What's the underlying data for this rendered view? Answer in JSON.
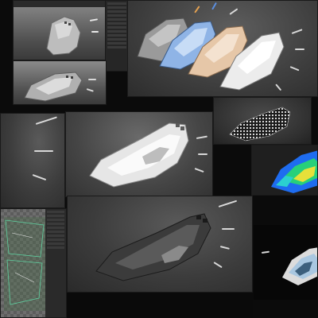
{
  "colors": {
    "background": "#0b0b0b",
    "viewport_grey": "#4e4e4e",
    "viewport_dark": "#3c3c3c",
    "model_white": "#e6e6e6",
    "model_blue": "#8fb4e6",
    "model_peach": "#e6c7a8",
    "heatmap_blue": "#1e6cf0",
    "heatmap_green": "#27d07a",
    "heatmap_yellow": "#e6e03a",
    "panel_chrome": "#2b2b2b"
  },
  "icons": {
    "close": "close-icon",
    "speed_line": "speed-line-icon"
  },
  "panels": [
    "viewport-top-left-small",
    "viewport-variants-lineup",
    "viewport-bottom-left-wide",
    "viewport-center-main",
    "viewport-wireframe",
    "viewport-heatmap",
    "viewport-uv-editor",
    "viewport-dark-render",
    "viewport-final-render"
  ]
}
